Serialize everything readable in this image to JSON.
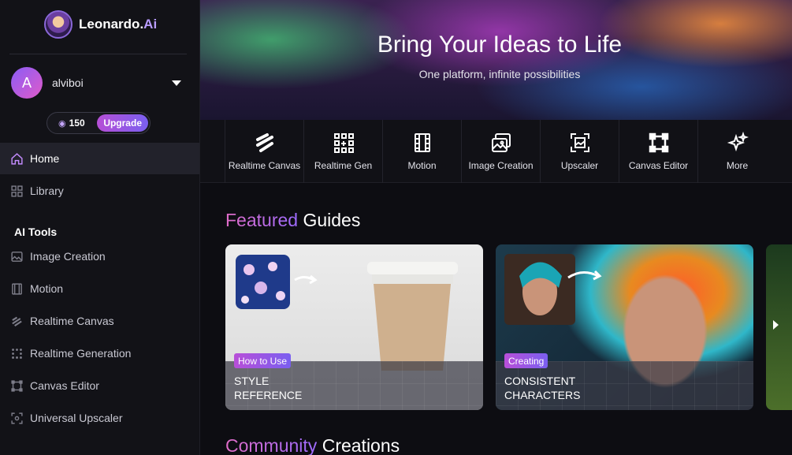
{
  "brand": {
    "name": "Leonardo.",
    "suffix": "Ai"
  },
  "user": {
    "initial": "A",
    "name": "alviboi"
  },
  "tokens": {
    "count": "150",
    "upgrade_label": "Upgrade"
  },
  "nav": {
    "home": "Home",
    "library": "Library",
    "ai_tools_heading": "AI Tools",
    "items": [
      "Image Creation",
      "Motion",
      "Realtime Canvas",
      "Realtime Generation",
      "Canvas Editor",
      "Universal Upscaler"
    ]
  },
  "hero": {
    "title": "Bring Your Ideas to Life",
    "subtitle": "One platform, infinite possibilities"
  },
  "tools": [
    {
      "label": "Realtime Canvas",
      "icon": "realtime-canvas-icon"
    },
    {
      "label": "Realtime Gen",
      "icon": "realtime-gen-icon"
    },
    {
      "label": "Motion",
      "icon": "film-icon"
    },
    {
      "label": "Image Creation",
      "icon": "image-icon"
    },
    {
      "label": "Upscaler",
      "icon": "upscaler-icon"
    },
    {
      "label": "Canvas Editor",
      "icon": "canvas-editor-icon"
    },
    {
      "label": "More",
      "icon": "sparkle-icon"
    }
  ],
  "featured": {
    "accent": "Featured",
    "rest": " Guides",
    "cards": [
      {
        "tag": "How to Use",
        "title_line1": "STYLE",
        "title_line2": "REFERENCE"
      },
      {
        "tag": "Creating",
        "title_line1": "CONSISTENT",
        "title_line2": "CHARACTERS"
      }
    ]
  },
  "community": {
    "accent": "Community",
    "rest": " Creations"
  },
  "colors": {
    "accent_pink": "#e06cc7",
    "accent_purple": "#9d6bff",
    "sidebar_bg": "#121217"
  }
}
